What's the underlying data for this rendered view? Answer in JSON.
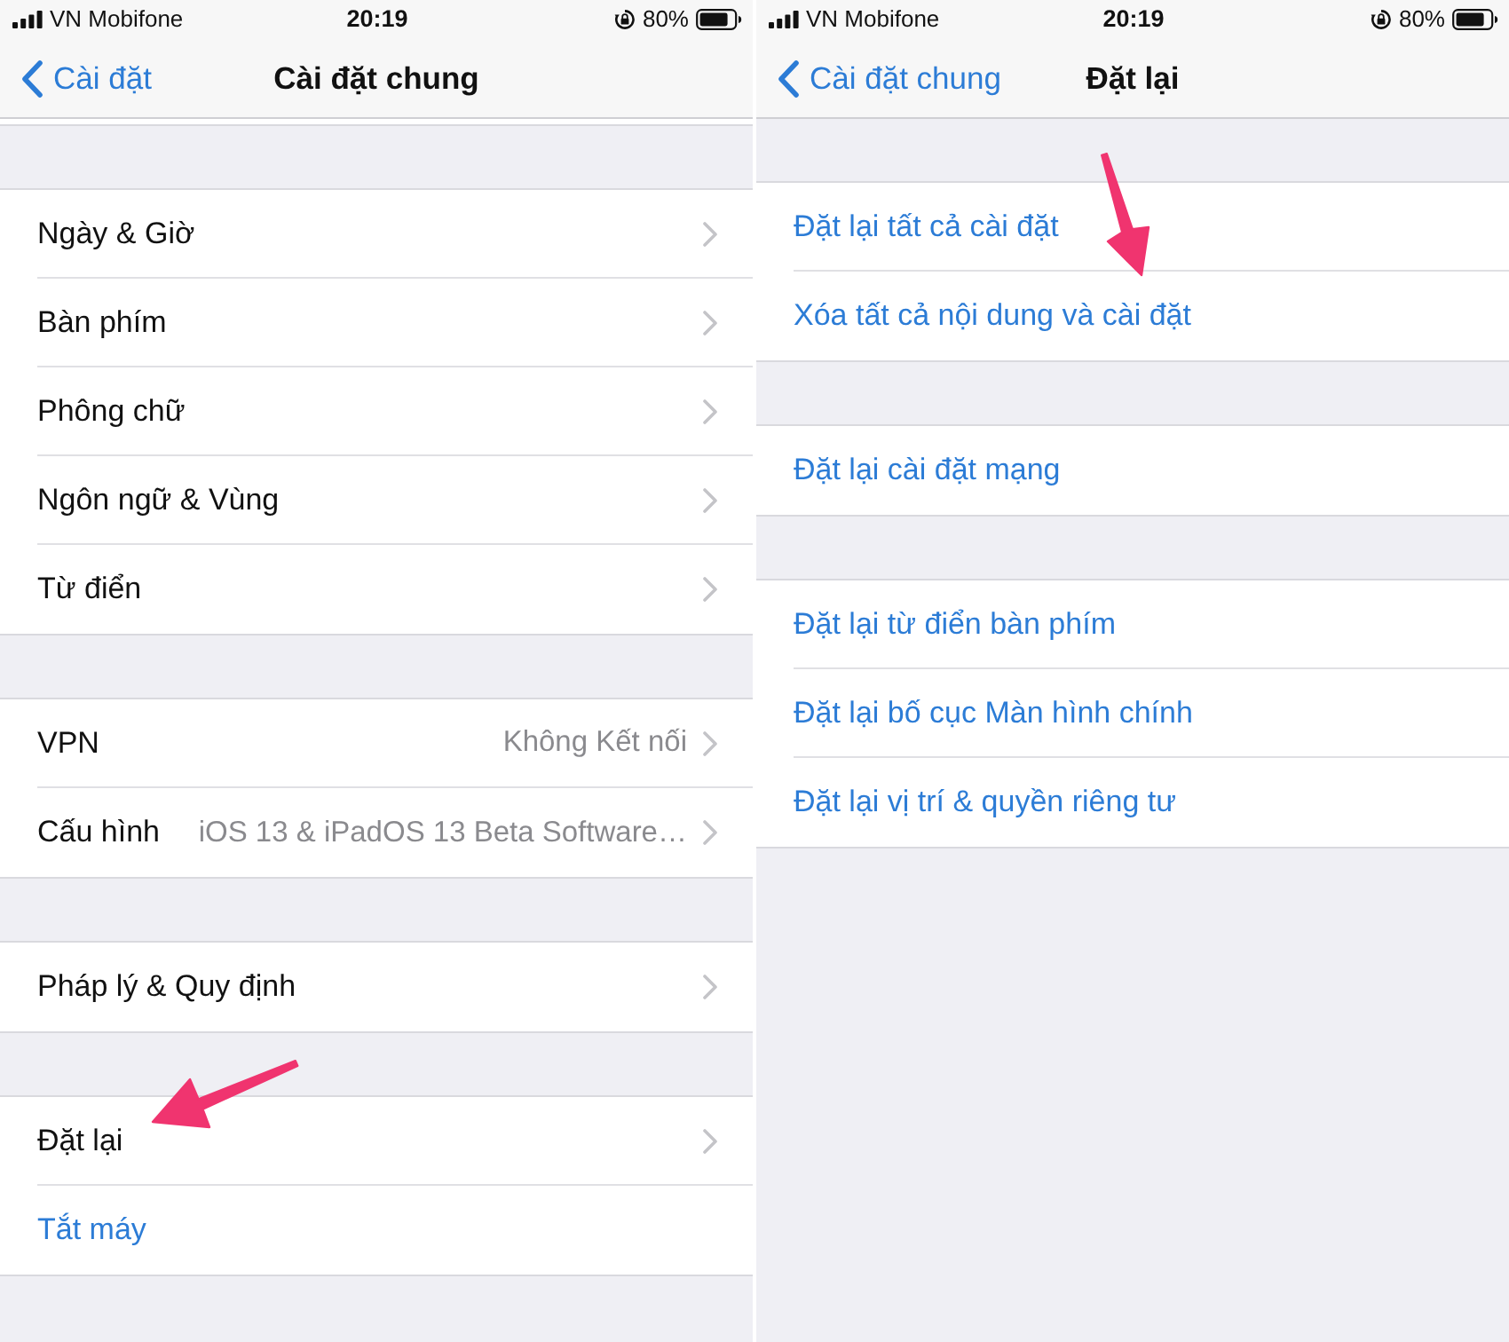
{
  "panels": [
    {
      "status_bar": {
        "carrier": "VN Mobifone",
        "time": "20:19",
        "battery": "80%"
      },
      "nav": {
        "back": "Cài đặt",
        "title": "Cài đặt chung"
      },
      "scrolled": true,
      "arrow": true,
      "groups": [
        {
          "rows": [
            {
              "kind": "disclosure",
              "label": "Ngày & Giờ"
            },
            {
              "kind": "disclosure",
              "label": "Bàn phím"
            },
            {
              "kind": "disclosure",
              "label": "Phông chữ"
            },
            {
              "kind": "disclosure",
              "label": "Ngôn ngữ & Vùng"
            },
            {
              "kind": "disclosure",
              "label": "Từ điển"
            }
          ]
        },
        {
          "rows": [
            {
              "kind": "disclosure",
              "label": "VPN",
              "value": "Không Kết nối"
            },
            {
              "kind": "disclosure",
              "label": "Cấu hình",
              "value": "iOS 13 & iPadOS 13 Beta Software…"
            }
          ]
        },
        {
          "rows": [
            {
              "kind": "disclosure",
              "label": "Pháp lý & Quy định"
            }
          ]
        },
        {
          "rows": [
            {
              "kind": "disclosure",
              "label": "Đặt lại"
            },
            {
              "kind": "action",
              "label": "Tắt máy"
            }
          ]
        }
      ]
    },
    {
      "status_bar": {
        "carrier": "VN Mobifone",
        "time": "20:19",
        "battery": "80%"
      },
      "nav": {
        "back": "Cài đặt chung",
        "title": "Đặt lại"
      },
      "scrolled": false,
      "arrow": true,
      "groups": [
        {
          "rows": [
            {
              "kind": "action",
              "label": "Đặt lại tất cả cài đặt"
            },
            {
              "kind": "action",
              "label": "Xóa tất cả nội dung và cài đặt"
            }
          ]
        },
        {
          "rows": [
            {
              "kind": "action",
              "label": "Đặt lại cài đặt mạng"
            }
          ]
        },
        {
          "rows": [
            {
              "kind": "action",
              "label": "Đặt lại từ điển bàn phím"
            },
            {
              "kind": "action",
              "label": "Đặt lại bố cục Màn hình chính"
            },
            {
              "kind": "action",
              "label": "Đặt lại vị trí & quyền riêng tư"
            }
          ]
        }
      ]
    }
  ]
}
